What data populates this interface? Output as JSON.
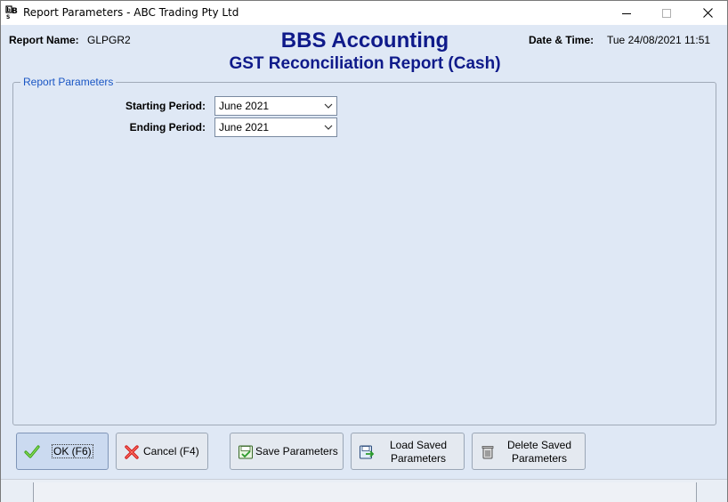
{
  "window": {
    "title": "Report Parameters - ABC Trading Pty Ltd",
    "icon": "bbs-app-icon"
  },
  "header": {
    "report_name_label": "Report Name:",
    "report_name_value": "GLPGR2",
    "app_title": "BBS Accounting",
    "report_title": "GST Reconciliation Report (Cash)",
    "datetime_label": "Date & Time:",
    "datetime_value": "Tue 24/08/2021 11:51"
  },
  "parameters": {
    "legend": "Report Parameters",
    "starting_period_label": "Starting Period:",
    "starting_period_value": "June 2021",
    "ending_period_label": "Ending Period:",
    "ending_period_value": "June 2021"
  },
  "buttons": {
    "ok": "OK (F6)",
    "cancel": "Cancel (F4)",
    "save": "Save Parameters",
    "load_line1": "Load Saved",
    "load_line2": "Parameters",
    "delete_line1": "Delete Saved",
    "delete_line2": "Parameters"
  },
  "colors": {
    "title_blue": "#0f1a8a",
    "legend_blue": "#1a56c4",
    "background": "#dfe8f5"
  }
}
